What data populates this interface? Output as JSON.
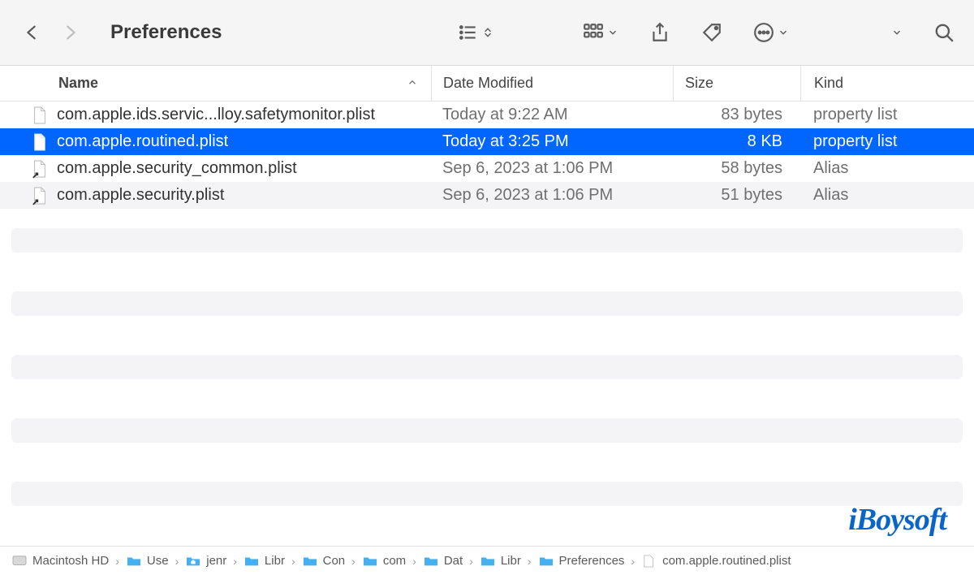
{
  "window": {
    "title": "Preferences"
  },
  "columns": {
    "name": "Name",
    "date": "Date Modified",
    "size": "Size",
    "kind": "Kind"
  },
  "files": [
    {
      "name": "com.apple.ids.servic...lloy.safetymonitor.plist",
      "date": "Today at 9:22 AM",
      "size": "83 bytes",
      "kind": "property list",
      "icon": "document",
      "selected": false
    },
    {
      "name": "com.apple.routined.plist",
      "date": "Today at 3:25 PM",
      "size": "8 KB",
      "kind": "property list",
      "icon": "document",
      "selected": true
    },
    {
      "name": "com.apple.security_common.plist",
      "date": "Sep 6, 2023 at 1:06 PM",
      "size": "58 bytes",
      "kind": "Alias",
      "icon": "alias",
      "selected": false
    },
    {
      "name": "com.apple.security.plist",
      "date": "Sep 6, 2023 at 1:06 PM",
      "size": "51 bytes",
      "kind": "Alias",
      "icon": "alias",
      "selected": false
    }
  ],
  "pathbar": [
    {
      "label": "Macintosh HD",
      "icon": "disk"
    },
    {
      "label": "Use",
      "icon": "folder"
    },
    {
      "label": "jenr",
      "icon": "home-folder"
    },
    {
      "label": "Libr",
      "icon": "folder"
    },
    {
      "label": "Con",
      "icon": "folder"
    },
    {
      "label": "com",
      "icon": "folder"
    },
    {
      "label": "Dat",
      "icon": "folder"
    },
    {
      "label": "Libr",
      "icon": "folder"
    },
    {
      "label": "Preferences",
      "icon": "folder"
    },
    {
      "label": "com.apple.routined.plist",
      "icon": "document"
    }
  ],
  "watermark": "iBoysoft"
}
